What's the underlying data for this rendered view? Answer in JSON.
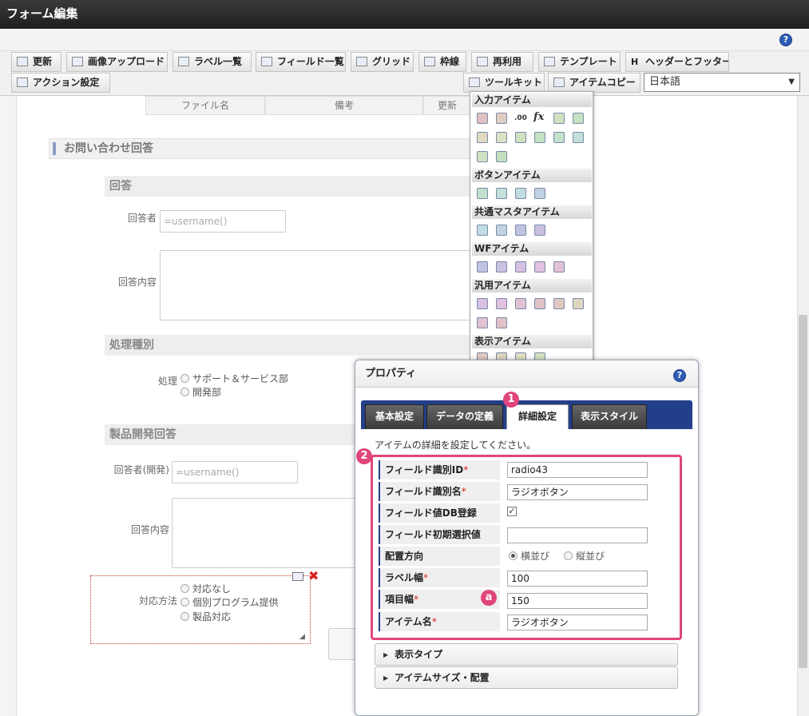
{
  "window": {
    "title": "フォーム編集"
  },
  "toolbar": {
    "row1": [
      {
        "label": "更新",
        "icon": "refresh-icon"
      },
      {
        "label": "画像アップロード",
        "icon": "image-upload-icon"
      },
      {
        "label": "ラベル一覧",
        "icon": "label-list-icon"
      },
      {
        "label": "フィールド一覧",
        "icon": "field-list-icon"
      },
      {
        "label": "グリッド",
        "icon": "grid-icon"
      },
      {
        "label": "枠線",
        "icon": "border-icon"
      },
      {
        "label": "再利用",
        "icon": "reuse-icon"
      },
      {
        "label": "テンプレート",
        "icon": "template-icon"
      },
      {
        "label": "ヘッダーとフッター",
        "icon": "header-footer-icon"
      }
    ],
    "row2": [
      {
        "label": "アクション設定",
        "icon": "action-icon"
      },
      {
        "label": "ツールキット",
        "icon": "toolkit-icon"
      },
      {
        "label": "アイテムコピー",
        "icon": "item-copy-icon"
      }
    ],
    "language": "日本語",
    "header_footer_glyph": "H"
  },
  "table_header": [
    "ファイル名",
    "備考",
    "更新"
  ],
  "form": {
    "section_title": "お問い合わせ回答",
    "answer_group": "回答",
    "answerer_label": "回答者",
    "answerer_value": "=username()",
    "answer_content_label": "回答内容",
    "process_group": "処理種別",
    "process_label": "処理",
    "process_options": [
      "サポート＆サービス部",
      "開発部"
    ],
    "dev_group": "製品開発回答",
    "dev_answerer_label": "回答者(開発)",
    "dev_answerer_value": "=username()",
    "dev_answer_content_label": "回答内容",
    "method_label": "対応方法",
    "method_options": [
      "対応なし",
      "個別プログラム提供",
      "製品対応"
    ]
  },
  "palette": {
    "categories": [
      "入力アイテム",
      "ボタンアイテム",
      "共通マスタアイテム",
      "WFアイテム",
      "汎用アイテム",
      "表示アイテム"
    ],
    "fx_glyph": "fx",
    "number_glyph": ".00"
  },
  "dialog": {
    "title": "プロパティ",
    "tabs": [
      "基本設定",
      "データの定義",
      "詳細設定",
      "表示スタイル"
    ],
    "active_tab": 2,
    "description": "アイテムの詳細を設定してください。",
    "properties": [
      {
        "label": "フィールド識別ID",
        "required": true,
        "value": "radio43"
      },
      {
        "label": "フィールド識別名",
        "required": true,
        "value": "ラジオボタン"
      },
      {
        "label": "フィールド値DB登録",
        "required": false,
        "checked": true
      },
      {
        "label": "フィールド初期選択値",
        "required": false,
        "value": ""
      },
      {
        "label": "配置方向",
        "required": false,
        "options": [
          "横並び",
          "縦並び"
        ],
        "selected": 0
      },
      {
        "label": "ラベル幅",
        "required": true,
        "value": "100"
      },
      {
        "label": "項目幅",
        "required": true,
        "value": "150"
      },
      {
        "label": "アイテム名",
        "required": true,
        "value": "ラジオボタン"
      }
    ],
    "required_mark": "*",
    "sections": [
      "表示タイプ",
      "アイテムサイズ・配置"
    ]
  },
  "annotations": {
    "badge1": "1",
    "badge2": "2",
    "badge_a": "a"
  },
  "colors": {
    "accent": "#e0457b",
    "tab_bar": "#243f8a",
    "title_bar": "#2b2b2b"
  }
}
